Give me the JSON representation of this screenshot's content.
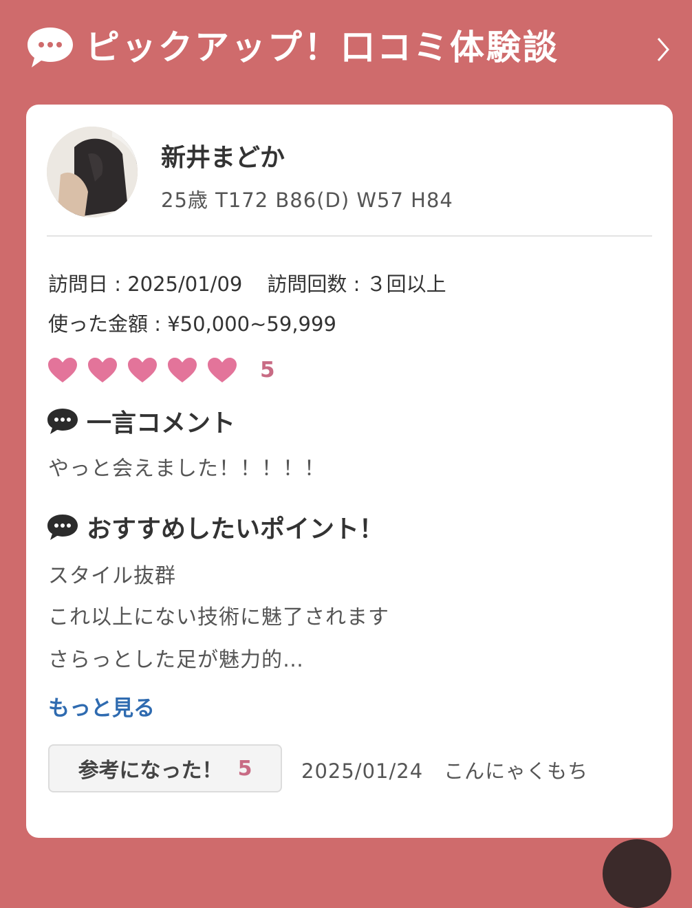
{
  "header": {
    "title": "ピックアップ！口コミ体験談",
    "bubble_icon": "speech-bubble-icon",
    "chevron_icon": "chevron-right-icon"
  },
  "profile": {
    "name": "新井まどか",
    "stats": "25歳  T172  B86(D)  W57  H84"
  },
  "visit": {
    "date": "訪問日 : 2025/01/09",
    "count": "訪問回数 : ３回以上",
    "amount": "使った金額 : ¥50,000~59,999"
  },
  "rating": {
    "hearts": 5,
    "value": "5",
    "heart_color": "#e3749a"
  },
  "comment": {
    "title": "一言コメント",
    "text": "やっと会えました！！！！！"
  },
  "points": {
    "title": "おすすめしたいポイント！",
    "lines": [
      "スタイル抜群",
      "これ以上にない技術に魅了されます",
      "さらっとした足が魅力的…"
    ]
  },
  "more_link": "もっと見る",
  "footer": {
    "helpful_label": "参考になった！",
    "helpful_count": "5",
    "post_date": "2025/01/24",
    "author": "こんにゃくもち"
  },
  "colors": {
    "background": "#cf6b6c",
    "accent_pink": "#c86b84",
    "link_blue": "#2f6bb0"
  }
}
